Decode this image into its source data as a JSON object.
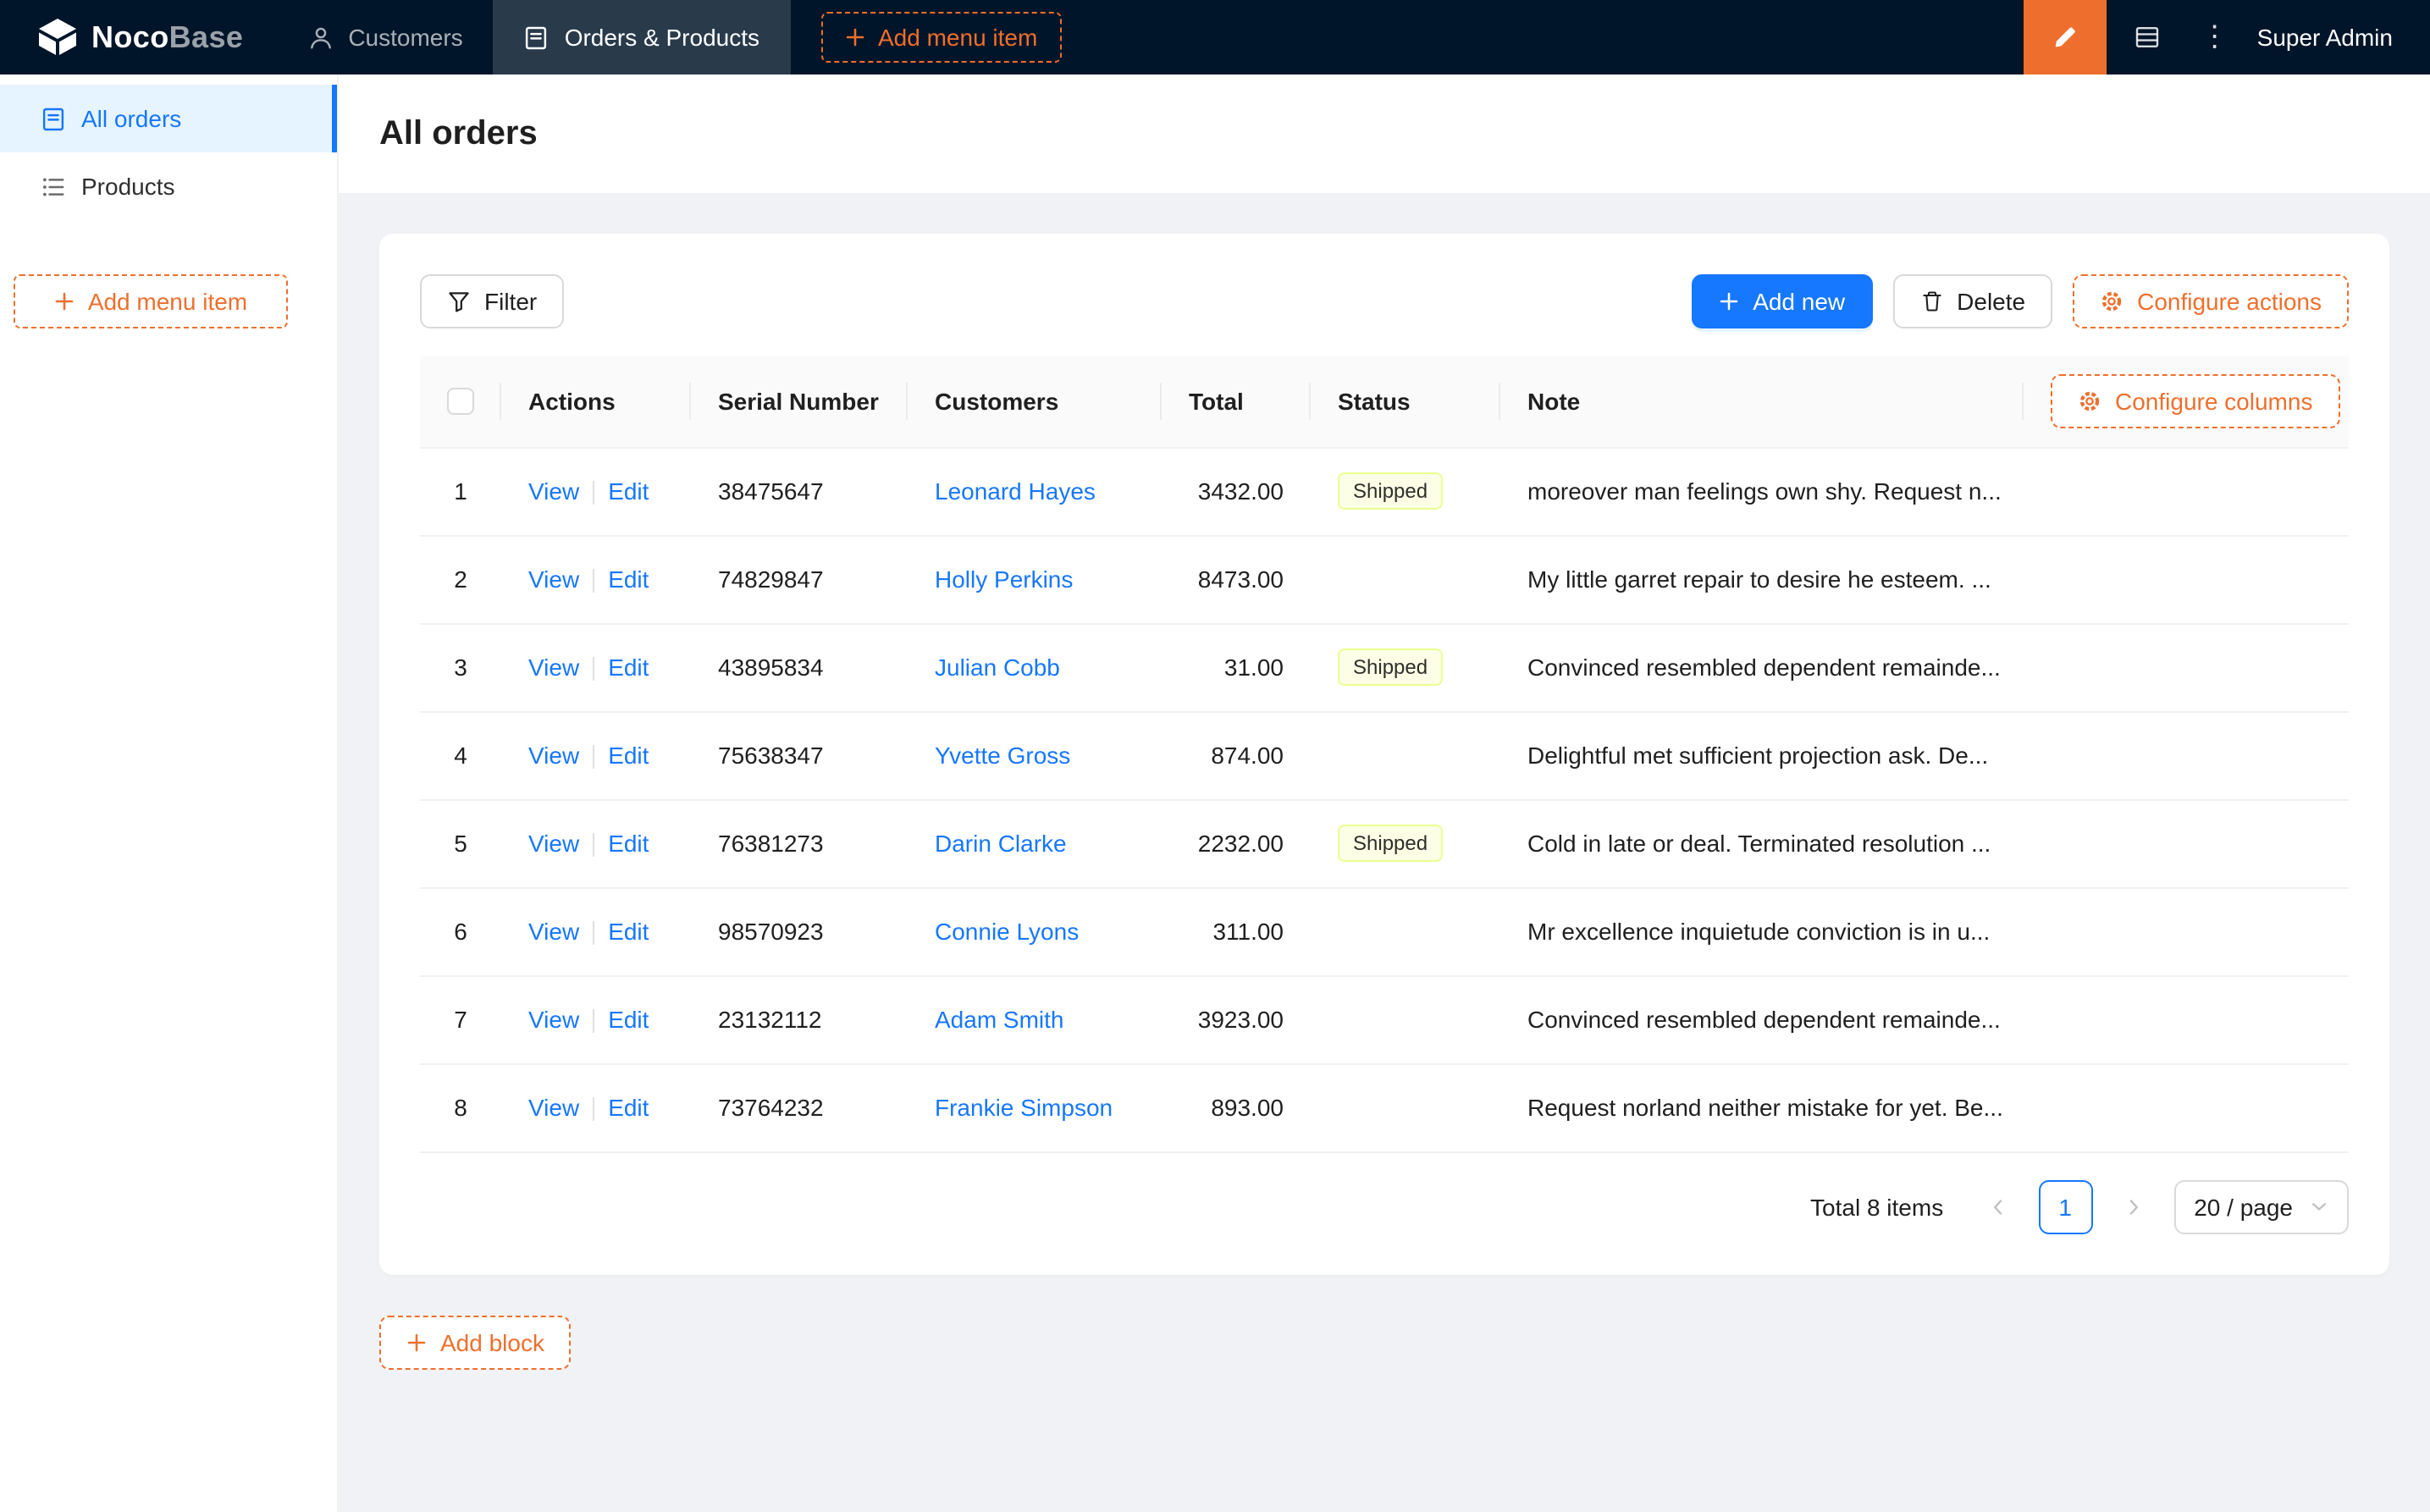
{
  "colors": {
    "accent": "#ee6f2d",
    "primary": "#1677ff",
    "navbar": "#001529",
    "tag_bg": "#fcffe6",
    "tag_border": "#eaff8f"
  },
  "icons": {
    "logo": "cube-icon",
    "customers_tab": "user-icon",
    "orders_tab": "form-icon",
    "add_menu": "plus-icon",
    "ui_editor": "pen-icon",
    "admin_tools": "table-icon",
    "more": "kebab-icon",
    "all_orders": "form-icon",
    "products": "list-icon",
    "filter": "filter-icon",
    "delete": "trash-icon",
    "configure": "gear-icon",
    "pagination": "chevron-icons"
  },
  "navbar": {
    "logo_noco": "Noco",
    "logo_base": "Base",
    "items": [
      {
        "label": "Customers"
      },
      {
        "label": "Orders & Products"
      }
    ],
    "add_menu_item": "Add menu item",
    "user": "Super Admin"
  },
  "sidebar": {
    "items": [
      {
        "label": "All orders"
      },
      {
        "label": "Products"
      }
    ],
    "add_menu_item": "Add menu item"
  },
  "page": {
    "title": "All orders",
    "add_block": "Add block"
  },
  "toolbar": {
    "filter": "Filter",
    "add_new": "Add new",
    "delete": "Delete",
    "configure_actions": "Configure actions"
  },
  "table": {
    "columns": [
      "Actions",
      "Serial Number",
      "Customers",
      "Total",
      "Status",
      "Note"
    ],
    "configure_columns": "Configure columns",
    "view_label": "View",
    "edit_label": "Edit",
    "rows": [
      {
        "index": "1",
        "serial": "38475647",
        "customer": "Leonard Hayes",
        "total": "3432.00",
        "status": "Shipped",
        "note": "moreover man feelings own shy. Request n..."
      },
      {
        "index": "2",
        "serial": "74829847",
        "customer": "Holly Perkins",
        "total": "8473.00",
        "status": "",
        "note": "My little garret repair to desire he esteem. ..."
      },
      {
        "index": "3",
        "serial": "43895834",
        "customer": "Julian Cobb",
        "total": "31.00",
        "status": "Shipped",
        "note": "Convinced resembled dependent remainde..."
      },
      {
        "index": "4",
        "serial": "75638347",
        "customer": "Yvette Gross",
        "total": "874.00",
        "status": "",
        "note": "Delightful met sufficient projection ask. De..."
      },
      {
        "index": "5",
        "serial": "76381273",
        "customer": "Darin Clarke",
        "total": "2232.00",
        "status": "Shipped",
        "note": "Cold in late or deal. Terminated resolution ..."
      },
      {
        "index": "6",
        "serial": "98570923",
        "customer": "Connie Lyons",
        "total": "311.00",
        "status": "",
        "note": "Mr excellence inquietude conviction is in u..."
      },
      {
        "index": "7",
        "serial": "23132112",
        "customer": "Adam Smith",
        "total": "3923.00",
        "status": "",
        "note": "Convinced resembled dependent remainde..."
      },
      {
        "index": "8",
        "serial": "73764232",
        "customer": "Frankie Simpson",
        "total": "893.00",
        "status": "",
        "note": "Request norland neither mistake for yet. Be..."
      }
    ]
  },
  "pagination": {
    "total_label": "Total 8 items",
    "page": "1",
    "page_size": "20 / page"
  }
}
